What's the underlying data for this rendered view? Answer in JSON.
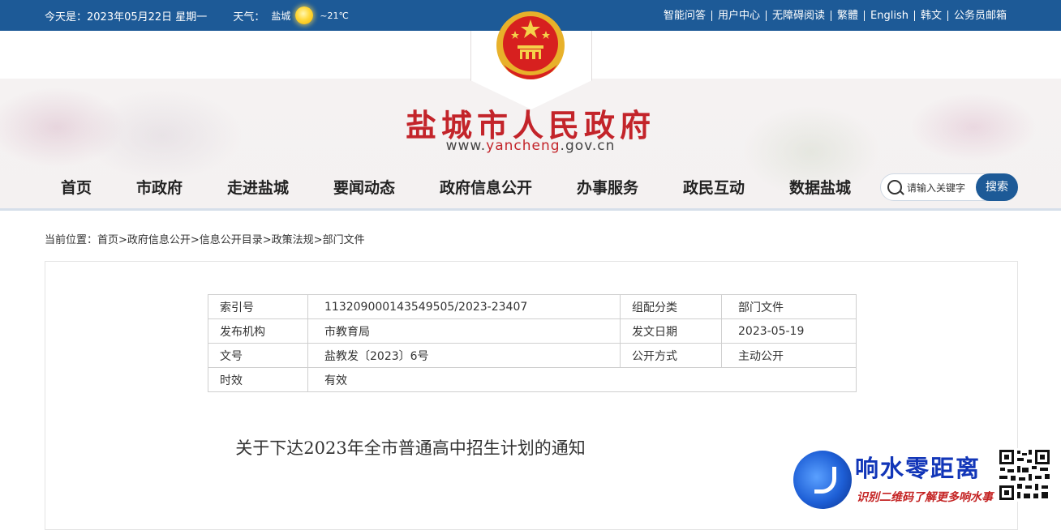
{
  "topbar": {
    "date": "今天是：2023年05月22日 星期一",
    "weather_label": "天气：",
    "city": "盐城",
    "temperature": "~21℃",
    "weather_icon": "sun-icon",
    "links": [
      "智能问答",
      "用户中心",
      "无障碍阅读",
      "繁體",
      "English",
      "韩文",
      "公务员邮箱"
    ]
  },
  "header": {
    "title": "盐城市人民政府",
    "url_prefix": "www.",
    "url_mid": "yancheng",
    "url_suffix": ".gov.cn"
  },
  "nav": {
    "items": [
      "首页",
      "市政府",
      "走进盐城",
      "要闻动态",
      "政府信息公开",
      "办事服务",
      "政民互动",
      "数据盐城"
    ]
  },
  "search": {
    "placeholder": "请输入关键字",
    "button_label": "搜索"
  },
  "breadcrumb": "当前位置：首页>政府信息公开>信息公开目录>政策法规>部门文件",
  "meta": {
    "rows": [
      {
        "k1": "索引号",
        "v1": "113209000143549505/2023-23407",
        "k2": "组配分类",
        "v2": "部门文件"
      },
      {
        "k1": "发布机构",
        "v1": "市教育局",
        "k2": "发文日期",
        "v2": "2023-05-19"
      },
      {
        "k1": "文号",
        "v1": "盐教发〔2023〕6号",
        "k2": "公开方式",
        "v2": "主动公开"
      },
      {
        "k1": "时效",
        "v1": "有效"
      }
    ]
  },
  "document": {
    "title": "关于下达2023年全市普通高中招生计划的通知"
  },
  "badge": {
    "name": "响水零距离",
    "subtitle": "识别二维码了解更多响水事"
  },
  "colors": {
    "primary": "#1d5a97",
    "title_red": "#c3242a"
  }
}
